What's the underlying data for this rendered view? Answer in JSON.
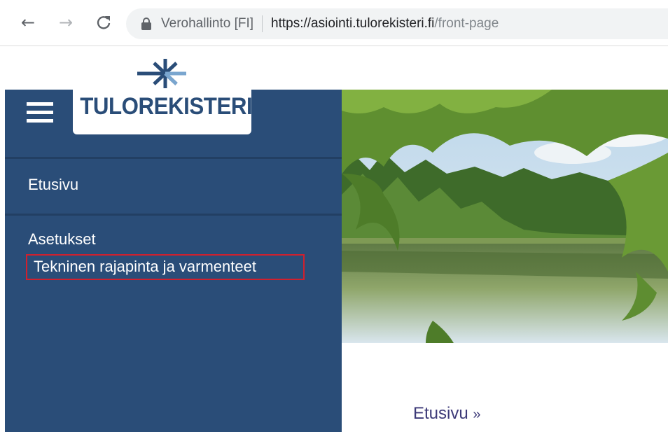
{
  "browser": {
    "site_name": "Verohallinto [FI]",
    "url_host": "https://asiointi.tulorekisteri.fi",
    "url_path": "/front-page",
    "icons": [
      "back-arrow-icon",
      "forward-arrow-icon",
      "reload-icon",
      "lock-icon"
    ]
  },
  "logo": {
    "text": "TULOREKISTERI",
    "mark_icon": "asterisk-arrow-logo"
  },
  "sidebar": {
    "menu_icon": "hamburger-icon",
    "items": [
      {
        "label": "Etusivu"
      },
      {
        "label": "Asetukset"
      },
      {
        "label": "Tekninen rajapinta ja varmenteet",
        "highlighted": true
      }
    ]
  },
  "breadcrumb": {
    "label": "Etusivu",
    "separator": "»"
  },
  "colors": {
    "sidebar_bg": "#2a4d78",
    "logo_text": "#2a4d78",
    "logo_accent": "#7aa6cf",
    "highlight_border": "#d0202e",
    "breadcrumb_text": "#3d3a78"
  }
}
